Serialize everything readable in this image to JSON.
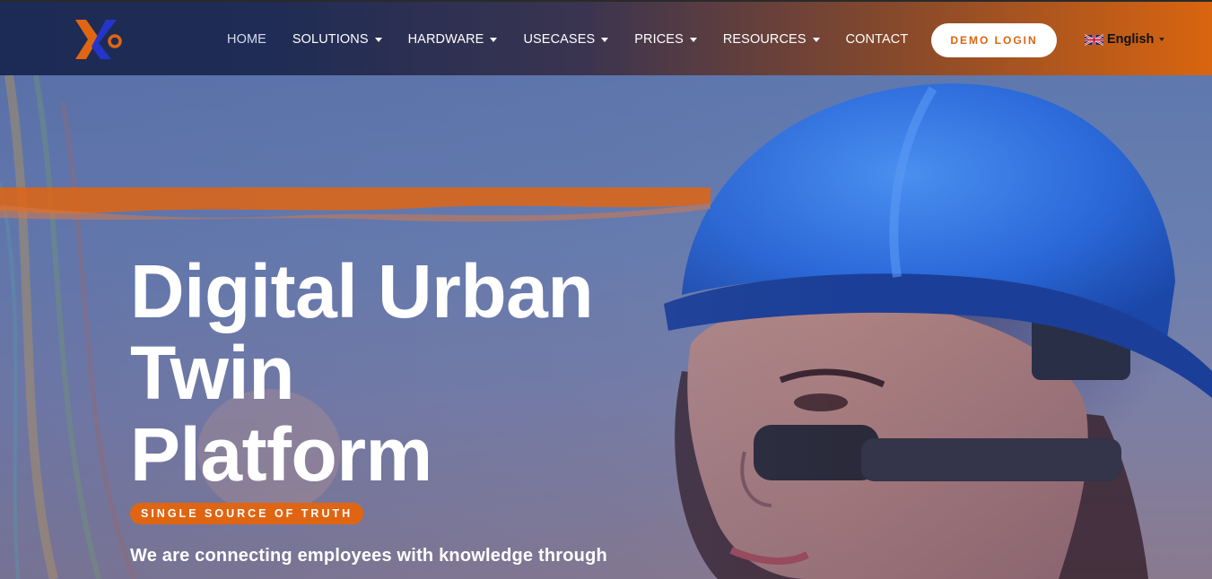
{
  "header": {
    "nav": [
      {
        "label": "HOME",
        "dropdown": false
      },
      {
        "label": "SOLUTIONS",
        "dropdown": true
      },
      {
        "label": "HARDWARE",
        "dropdown": true
      },
      {
        "label": "USECASES",
        "dropdown": true
      },
      {
        "label": "PRICES",
        "dropdown": true
      },
      {
        "label": "RESOURCES",
        "dropdown": true
      },
      {
        "label": "CONTACT",
        "dropdown": false
      }
    ],
    "demo_login_label": "DEMO LOGIN",
    "language": {
      "label": "English",
      "flag_icon": "uk-flag-icon"
    }
  },
  "hero": {
    "headline_lines": [
      "Digital Urban",
      "Twin",
      "Platform"
    ],
    "tag": "SINGLE SOURCE OF TRUTH",
    "subtext": "We are connecting employees with knowledge through"
  },
  "colors": {
    "brand_orange": "#e06512",
    "navy": "#1c2b55",
    "logo_blue": "#2436c9",
    "white": "#ffffff"
  }
}
